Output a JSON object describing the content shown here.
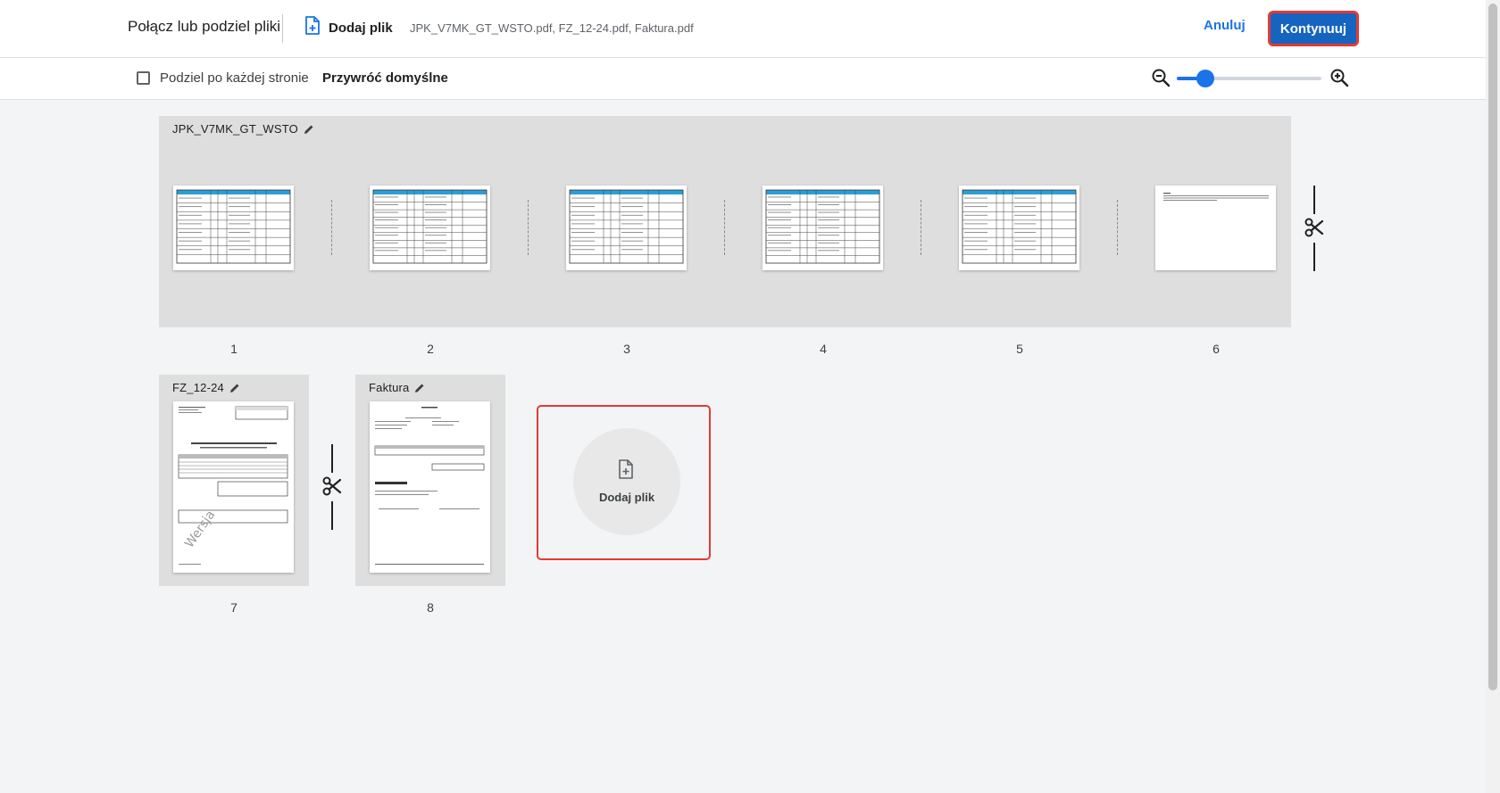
{
  "header": {
    "title": "Połącz lub podziel pliki",
    "add_file_label": "Dodaj plik",
    "files": "JPK_V7MK_GT_WSTO.pdf, FZ_12-24.pdf, Faktura.pdf",
    "cancel_label": "Anuluj",
    "continue_label": "Kontynuuj"
  },
  "toolbar": {
    "split_label": "Podziel po każdej stronie",
    "split_checked": false,
    "restore_label": "Przywróć domyślne",
    "zoom_level": 0.2
  },
  "groups": [
    {
      "name": "JPK_V7MK_GT_WSTO",
      "pages": [
        "1",
        "2",
        "3",
        "4",
        "5",
        "6"
      ]
    },
    {
      "name": "FZ_12-24",
      "pages": [
        "7"
      ]
    },
    {
      "name": "Faktura",
      "pages": [
        "8"
      ]
    }
  ],
  "add_card": {
    "label": "Dodaj plik"
  },
  "colors": {
    "accent": "#1a73e8",
    "highlight": "#e53935",
    "table_header": "#2a9fd6"
  }
}
